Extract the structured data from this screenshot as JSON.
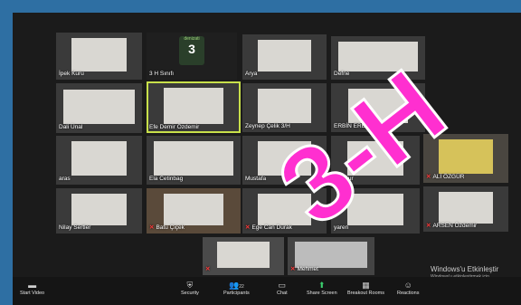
{
  "logo_text": "denizati",
  "logo_letter": "3",
  "participants": [
    {
      "id": "ipek",
      "name": "İpek Kuru",
      "muted": false
    },
    {
      "id": "class",
      "name": "3 H Sınıfı",
      "muted": false
    },
    {
      "id": "arya",
      "name": "Arya",
      "muted": false
    },
    {
      "id": "defne",
      "name": "Defne",
      "muted": false
    },
    {
      "id": "dali",
      "name": "Dali Ünal",
      "muted": false
    },
    {
      "id": "efe",
      "name": "Efe Demir Özdemir",
      "muted": false
    },
    {
      "id": "zeynep",
      "name": "Zeynep Çelik 3/H",
      "muted": false
    },
    {
      "id": "erem",
      "name": "ERBİN EREM ŞİR",
      "muted": false
    },
    {
      "id": "aras",
      "name": "aras",
      "muted": false
    },
    {
      "id": "ela",
      "name": "Ela Cetinbag",
      "muted": false
    },
    {
      "id": "mustafa",
      "name": "Mustafa",
      "muted": false
    },
    {
      "id": "yagmur",
      "name": "yağmur",
      "muted": false
    },
    {
      "id": "ali",
      "name": "ALİ ÖZGÜR",
      "muted": true
    },
    {
      "id": "nilay",
      "name": "Nilay Sertler",
      "muted": false
    },
    {
      "id": "batu",
      "name": "Batu Çiçek",
      "muted": true
    },
    {
      "id": "ege",
      "name": "Ege Can Durak",
      "muted": true
    },
    {
      "id": "yaren",
      "name": "yaren",
      "muted": false
    },
    {
      "id": "arsen",
      "name": "ARSEN Özdemir",
      "muted": true
    },
    {
      "id": "tile19",
      "name": "",
      "muted": true
    },
    {
      "id": "mehmet",
      "name": "Mehmet",
      "muted": true
    }
  ],
  "toolbar": {
    "start_video": "Start Video",
    "security": "Security",
    "participants": "Participants",
    "participants_count": "22",
    "chat": "Chat",
    "share_screen": "Share Screen",
    "breakout_rooms": "Breakout Rooms",
    "reactions": "Reactions"
  },
  "watermark": {
    "title": "Windows'u Etkinleştir",
    "subtitle": "Windows'u etkinleştirmek için"
  },
  "overlay_text": "3-H",
  "colors": {
    "overlay_fill": "#ff2fd0",
    "active_border": "#c8e04a",
    "share_green": "#3bd16f"
  }
}
